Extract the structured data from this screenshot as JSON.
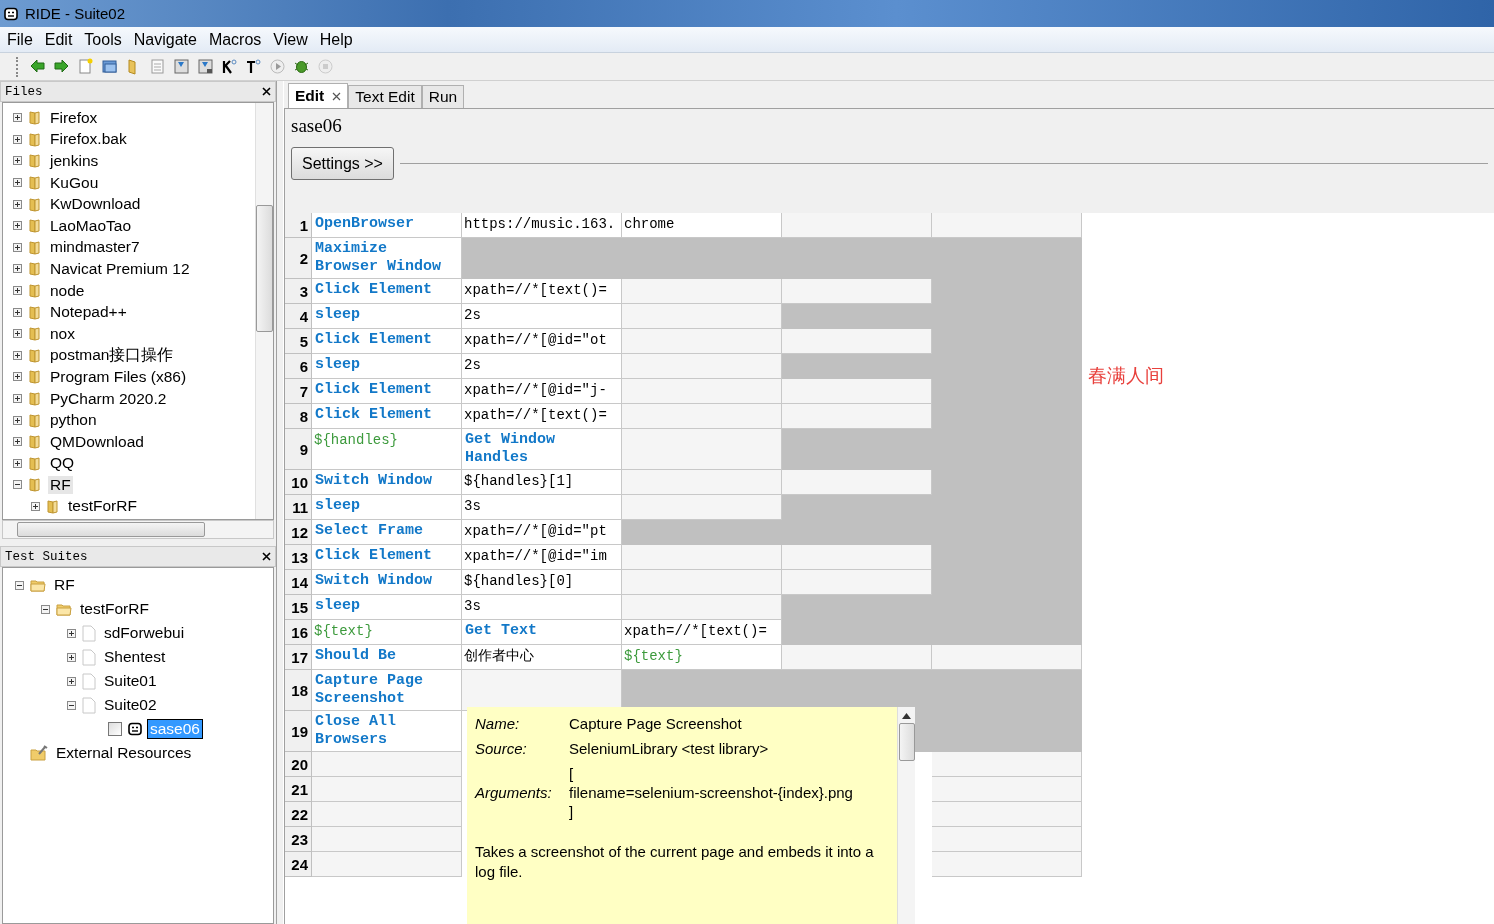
{
  "window": {
    "title": "RIDE - Suite02"
  },
  "menu": [
    "File",
    "Edit",
    "Tools",
    "Navigate",
    "Macros",
    "View",
    "Help"
  ],
  "files_panel": {
    "title": "Files",
    "items": [
      {
        "label": "Firefox",
        "expanded": false,
        "selected": false
      },
      {
        "label": "Firefox.bak",
        "expanded": false,
        "selected": false
      },
      {
        "label": "jenkins",
        "expanded": false,
        "selected": false
      },
      {
        "label": "KuGou",
        "expanded": false,
        "selected": false
      },
      {
        "label": "KwDownload",
        "expanded": false,
        "selected": false
      },
      {
        "label": "LaoMaoTao",
        "expanded": false,
        "selected": false
      },
      {
        "label": "mindmaster7",
        "expanded": false,
        "selected": false
      },
      {
        "label": "Navicat Premium 12",
        "expanded": false,
        "selected": false
      },
      {
        "label": "node",
        "expanded": false,
        "selected": false
      },
      {
        "label": "Notepad++",
        "expanded": false,
        "selected": false
      },
      {
        "label": "nox",
        "expanded": false,
        "selected": false
      },
      {
        "label": "postman接口操作",
        "expanded": false,
        "selected": false
      },
      {
        "label": "Program Files (x86)",
        "expanded": false,
        "selected": false
      },
      {
        "label": "PyCharm 2020.2",
        "expanded": false,
        "selected": false
      },
      {
        "label": "python",
        "expanded": false,
        "selected": false
      },
      {
        "label": "QMDownload",
        "expanded": false,
        "selected": false
      },
      {
        "label": "QQ",
        "expanded": false,
        "selected": false
      },
      {
        "label": "RF",
        "expanded": true,
        "selected": true,
        "children": [
          {
            "label": "testForRF",
            "expanded": false,
            "selected": false
          }
        ]
      }
    ]
  },
  "suites_panel": {
    "title": "Test Suites",
    "items": [
      {
        "label": "RF",
        "kind": "folder",
        "expanded": true,
        "selected": false,
        "children": [
          {
            "label": "testForRF",
            "kind": "folder",
            "expanded": true,
            "selected": false,
            "children": [
              {
                "label": "sdForwebui",
                "kind": "suite",
                "expanded": false,
                "selected": false
              },
              {
                "label": "Shentest",
                "kind": "suite",
                "expanded": false,
                "selected": false
              },
              {
                "label": "Suite01",
                "kind": "suite",
                "expanded": false,
                "selected": false
              },
              {
                "label": "Suite02",
                "kind": "suite",
                "expanded": true,
                "selected": false,
                "children": [
                  {
                    "label": "sase06",
                    "kind": "test",
                    "checked": false,
                    "selected": true
                  }
                ]
              }
            ]
          }
        ]
      },
      {
        "label": "External Resources",
        "kind": "resources",
        "selected": false
      }
    ]
  },
  "tabs": [
    {
      "label": "Edit",
      "selected": true,
      "closable": true
    },
    {
      "label": "Text Edit",
      "selected": false,
      "closable": false
    },
    {
      "label": "Run",
      "selected": false,
      "closable": false
    }
  ],
  "editor": {
    "title": "sase06",
    "settings_button": "Settings >>",
    "rows": [
      {
        "number": "1",
        "cells": [
          {
            "kind": "keyword",
            "text": "OpenBrowser"
          },
          {
            "kind": "argument",
            "text": "https://music.163."
          },
          {
            "kind": "argument",
            "text": "chrome"
          },
          {
            "kind": "empty"
          },
          {
            "kind": "empty"
          }
        ]
      },
      {
        "number": "2",
        "cells": [
          {
            "kind": "keyword",
            "text": "Maximize Browser Window"
          },
          {
            "kind": "disabled"
          },
          {
            "kind": "disabled"
          },
          {
            "kind": "disabled"
          },
          {
            "kind": "disabled"
          }
        ]
      },
      {
        "number": "3",
        "cells": [
          {
            "kind": "keyword",
            "text": "Click Element"
          },
          {
            "kind": "argument",
            "text": "xpath=//*[text()="
          },
          {
            "kind": "empty"
          },
          {
            "kind": "empty"
          },
          {
            "kind": "disabled"
          }
        ]
      },
      {
        "number": "4",
        "cells": [
          {
            "kind": "keyword",
            "text": "sleep"
          },
          {
            "kind": "argument",
            "text": "2s"
          },
          {
            "kind": "empty"
          },
          {
            "kind": "disabled"
          },
          {
            "kind": "disabled"
          }
        ]
      },
      {
        "number": "5",
        "cells": [
          {
            "kind": "keyword",
            "text": "Click Element"
          },
          {
            "kind": "argument",
            "text": "xpath=//*[@id=\"ot"
          },
          {
            "kind": "empty"
          },
          {
            "kind": "empty"
          },
          {
            "kind": "disabled"
          }
        ]
      },
      {
        "number": "6",
        "cells": [
          {
            "kind": "keyword",
            "text": "sleep"
          },
          {
            "kind": "argument",
            "text": "2s"
          },
          {
            "kind": "empty"
          },
          {
            "kind": "disabled"
          },
          {
            "kind": "disabled"
          }
        ]
      },
      {
        "number": "7",
        "cells": [
          {
            "kind": "keyword",
            "text": "Click Element"
          },
          {
            "kind": "argument",
            "text": "xpath=//*[@id=\"j-"
          },
          {
            "kind": "empty"
          },
          {
            "kind": "empty"
          },
          {
            "kind": "disabled"
          }
        ]
      },
      {
        "number": "8",
        "cells": [
          {
            "kind": "keyword",
            "text": "Click Element"
          },
          {
            "kind": "argument",
            "text": "xpath=//*[text()="
          },
          {
            "kind": "empty"
          },
          {
            "kind": "empty"
          },
          {
            "kind": "disabled"
          }
        ]
      },
      {
        "number": "9",
        "cells": [
          {
            "kind": "variable",
            "text": "${handles}"
          },
          {
            "kind": "keyword",
            "text": "Get Window Handles"
          },
          {
            "kind": "empty"
          },
          {
            "kind": "disabled"
          },
          {
            "kind": "disabled"
          }
        ]
      },
      {
        "number": "10",
        "cells": [
          {
            "kind": "keyword",
            "text": "Switch Window"
          },
          {
            "kind": "argument",
            "text": "${handles}[1]"
          },
          {
            "kind": "empty"
          },
          {
            "kind": "empty"
          },
          {
            "kind": "disabled"
          }
        ]
      },
      {
        "number": "11",
        "cells": [
          {
            "kind": "keyword",
            "text": "sleep"
          },
          {
            "kind": "argument",
            "text": "3s"
          },
          {
            "kind": "empty"
          },
          {
            "kind": "disabled"
          },
          {
            "kind": "disabled"
          }
        ]
      },
      {
        "number": "12",
        "cells": [
          {
            "kind": "keyword",
            "text": "Select Frame"
          },
          {
            "kind": "argument",
            "text": "xpath=//*[@id=\"pt"
          },
          {
            "kind": "disabled"
          },
          {
            "kind": "disabled"
          },
          {
            "kind": "disabled"
          }
        ]
      },
      {
        "number": "13",
        "cells": [
          {
            "kind": "keyword",
            "text": "Click Element"
          },
          {
            "kind": "argument",
            "text": "xpath=//*[@id=\"im"
          },
          {
            "kind": "empty"
          },
          {
            "kind": "empty"
          },
          {
            "kind": "disabled"
          }
        ]
      },
      {
        "number": "14",
        "cells": [
          {
            "kind": "keyword",
            "text": "Switch Window"
          },
          {
            "kind": "argument",
            "text": "${handles}[0]"
          },
          {
            "kind": "empty"
          },
          {
            "kind": "empty"
          },
          {
            "kind": "disabled"
          }
        ]
      },
      {
        "number": "15",
        "cells": [
          {
            "kind": "keyword",
            "text": "sleep"
          },
          {
            "kind": "argument",
            "text": "3s"
          },
          {
            "kind": "empty"
          },
          {
            "kind": "disabled"
          },
          {
            "kind": "disabled"
          }
        ]
      },
      {
        "number": "16",
        "cells": [
          {
            "kind": "variable",
            "text": "${text}"
          },
          {
            "kind": "keyword",
            "text": "Get Text"
          },
          {
            "kind": "argument",
            "text": "xpath=//*[text()="
          },
          {
            "kind": "disabled"
          },
          {
            "kind": "disabled"
          }
        ]
      },
      {
        "number": "17",
        "cells": [
          {
            "kind": "keyword",
            "text": "Should Be"
          },
          {
            "kind": "argument",
            "text": "创作者中心"
          },
          {
            "kind": "variable",
            "text": "${text}"
          },
          {
            "kind": "empty"
          },
          {
            "kind": "empty"
          }
        ]
      },
      {
        "number": "18",
        "cells": [
          {
            "kind": "keyword",
            "text": "Capture Page Screenshot"
          },
          {
            "kind": "empty"
          },
          {
            "kind": "disabled"
          },
          {
            "kind": "disabled"
          },
          {
            "kind": "disabled"
          }
        ]
      },
      {
        "number": "19",
        "cells": [
          {
            "kind": "keyword",
            "text": "Close All Browsers"
          },
          {
            "kind": "covered"
          },
          {
            "kind": "covered"
          },
          {
            "kind": "disabled"
          },
          {
            "kind": "disabled"
          }
        ]
      },
      {
        "number": "20",
        "cells": [
          {
            "kind": "empty"
          },
          {
            "kind": "covered"
          },
          {
            "kind": "covered"
          },
          {
            "kind": "covered"
          },
          {
            "kind": "empty"
          }
        ]
      },
      {
        "number": "21",
        "cells": [
          {
            "kind": "empty"
          },
          {
            "kind": "covered"
          },
          {
            "kind": "covered"
          },
          {
            "kind": "covered"
          },
          {
            "kind": "empty"
          }
        ]
      },
      {
        "number": "22",
        "cells": [
          {
            "kind": "empty"
          },
          {
            "kind": "covered"
          },
          {
            "kind": "covered"
          },
          {
            "kind": "covered"
          },
          {
            "kind": "empty"
          }
        ]
      },
      {
        "number": "23",
        "cells": [
          {
            "kind": "empty"
          },
          {
            "kind": "covered"
          },
          {
            "kind": "covered"
          },
          {
            "kind": "covered"
          },
          {
            "kind": "empty"
          }
        ]
      },
      {
        "number": "24",
        "cells": [
          {
            "kind": "empty"
          },
          {
            "kind": "covered"
          },
          {
            "kind": "covered"
          },
          {
            "kind": "covered"
          },
          {
            "kind": "empty"
          }
        ]
      }
    ]
  },
  "annotation": "春满人间",
  "tooltip": {
    "fields": [
      {
        "label": "Name:",
        "lines": [
          "Capture Page Screenshot"
        ]
      },
      {
        "label": "Source:",
        "lines": [
          "SeleniumLibrary <test library>"
        ]
      },
      {
        "label": "Arguments:",
        "lines": [
          "[",
          "filename=selenium-screenshot-{index}.png",
          "]"
        ]
      }
    ],
    "description": "Takes a screenshot of the current page and embeds it into a log file."
  }
}
